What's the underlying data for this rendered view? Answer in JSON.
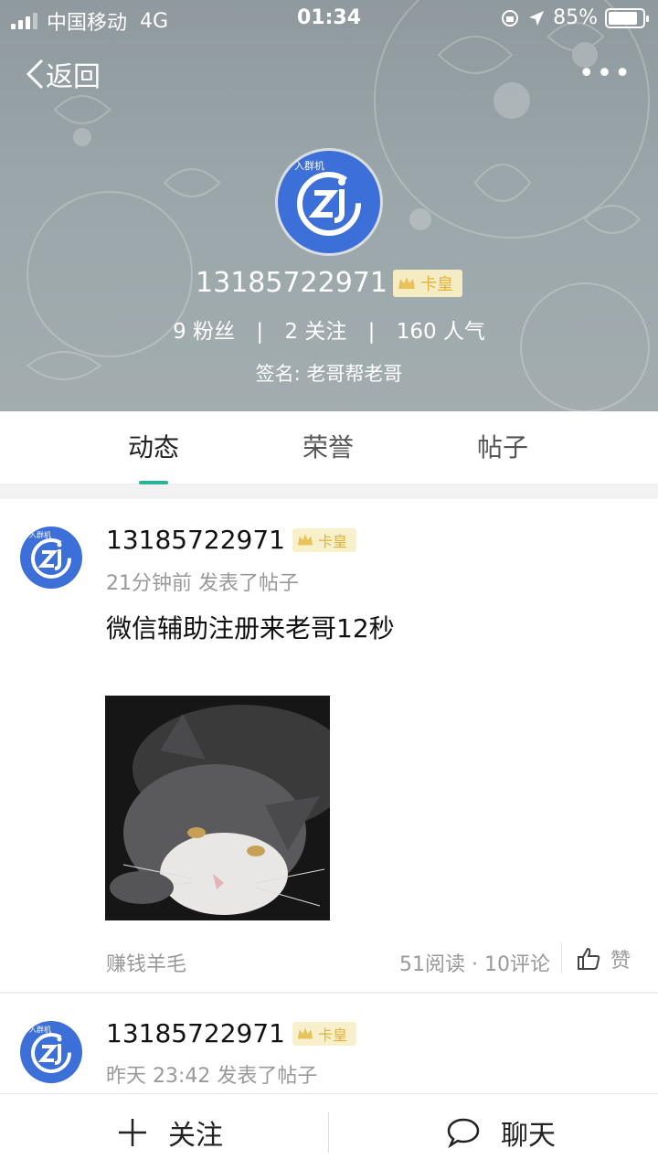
{
  "status_bar": {
    "carrier": "中国移动",
    "network": "4G",
    "time": "01:34",
    "battery": "85%",
    "battery_level": 0.85
  },
  "nav": {
    "back_label": "返回",
    "more_label": "•••"
  },
  "profile": {
    "avatar_tiny_text": "入群机",
    "username": "13185722971",
    "badge": "卡皇",
    "fans": "9 粉丝",
    "following": "2 关注",
    "popularity": "160 人气",
    "stats_sep": "|",
    "signature": "签名: 老哥帮老哥"
  },
  "tabs": [
    {
      "label": "动态",
      "active": true
    },
    {
      "label": "荣誉",
      "active": false
    },
    {
      "label": "帖子",
      "active": false
    }
  ],
  "posts": [
    {
      "username": "13185722971",
      "badge": "卡皇",
      "meta": "21分钟前 发表了帖子",
      "text": "微信辅助注册来老哥12秒",
      "tag": "赚钱羊毛",
      "counts": "51阅读 · 10评论",
      "like_label": "赞"
    },
    {
      "username": "13185722971",
      "badge": "卡皇",
      "meta": "昨天 23:42 发表了帖子"
    }
  ],
  "bottom_bar": {
    "follow_label": "关注",
    "chat_label": "聊天"
  },
  "colors": {
    "accent": "#2ab39c",
    "avatar_blue": "#3c6fd8",
    "badge_gold": "#e0b23c"
  }
}
